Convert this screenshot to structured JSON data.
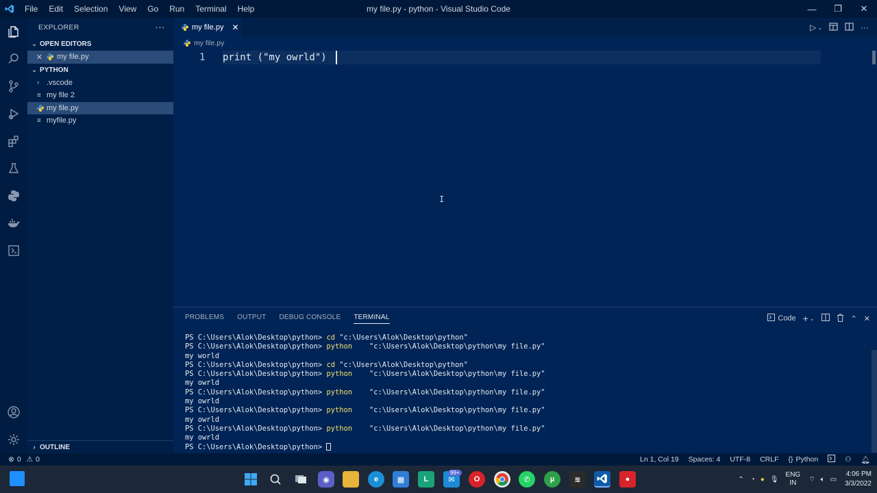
{
  "titlebar": {
    "menu": [
      "File",
      "Edit",
      "Selection",
      "View",
      "Go",
      "Run",
      "Terminal",
      "Help"
    ],
    "title": "my file.py - python - Visual Studio Code",
    "minimize": "—",
    "restore": "❐",
    "close": "✕"
  },
  "explorer": {
    "header": "EXPLORER",
    "more": "···",
    "open_editors_label": "OPEN EDITORS",
    "open_editors": [
      {
        "label": "my file.py"
      }
    ],
    "folder_label": "PYTHON",
    "items": [
      {
        "label": ".vscode",
        "kind": "folder"
      },
      {
        "label": "my file 2",
        "kind": "file"
      },
      {
        "label": "my file.py",
        "kind": "python",
        "selected": true
      },
      {
        "label": "myfile.py",
        "kind": "file"
      }
    ],
    "outline_label": "OUTLINE"
  },
  "tabs": [
    {
      "label": "my file.py",
      "active": true
    }
  ],
  "breadcrumb": "my file.py",
  "editor": {
    "line_number": "1",
    "code": "print (\"my owrld\")"
  },
  "panel": {
    "tabs": [
      "PROBLEMS",
      "OUTPUT",
      "DEBUG CONSOLE",
      "TERMINAL"
    ],
    "active_tab": "TERMINAL",
    "shell_label": "Code",
    "terminal_lines": [
      {
        "prompt": "PS C:\\Users\\Alok\\Desktop\\python>",
        "cmd": "cd",
        "arg": " \"c:\\Users\\Alok\\Desktop\\python\""
      },
      {
        "prompt": "PS C:\\Users\\Alok\\Desktop\\python>",
        "cmd": "python",
        "arg": "    \"c:\\Users\\Alok\\Desktop\\python\\my file.py\""
      },
      {
        "output": "my world"
      },
      {
        "prompt": "PS C:\\Users\\Alok\\Desktop\\python>",
        "cmd": "cd",
        "arg": " \"c:\\Users\\Alok\\Desktop\\python\""
      },
      {
        "prompt": "PS C:\\Users\\Alok\\Desktop\\python>",
        "cmd": "python",
        "arg": "    \"c:\\Users\\Alok\\Desktop\\python\\my file.py\""
      },
      {
        "output": "my owrld"
      },
      {
        "prompt": "PS C:\\Users\\Alok\\Desktop\\python>",
        "cmd": "python",
        "arg": "    \"c:\\Users\\Alok\\Desktop\\python\\my file.py\""
      },
      {
        "output": "my owrld"
      },
      {
        "prompt": "PS C:\\Users\\Alok\\Desktop\\python>",
        "cmd": "python",
        "arg": "    \"c:\\Users\\Alok\\Desktop\\python\\my file.py\""
      },
      {
        "output": "my owrld"
      },
      {
        "prompt": "PS C:\\Users\\Alok\\Desktop\\python>",
        "cmd": "python",
        "arg": "    \"c:\\Users\\Alok\\Desktop\\python\\my file.py\""
      },
      {
        "output": "my owrld"
      },
      {
        "prompt": "PS C:\\Users\\Alok\\Desktop\\python>",
        "cmd": "",
        "arg": " ",
        "cursor": true
      }
    ]
  },
  "statusbar": {
    "errors": "0",
    "warnings": "0",
    "position": "Ln 1, Col 19",
    "spaces": "Spaces: 4",
    "encoding": "UTF-8",
    "eol": "CRLF",
    "language": "Python"
  },
  "taskbar": {
    "mail_badge": "99+",
    "lang_top": "ENG",
    "lang_bottom": "IN",
    "time": "4:06 PM",
    "date": "3/3/2022"
  },
  "colors": {
    "editor_bg": "#012456",
    "titlebar_bg": "#00193a",
    "sidebar_bg": "#001f48",
    "selection": "#2b4c78",
    "terminal_command": "#f0e070"
  }
}
